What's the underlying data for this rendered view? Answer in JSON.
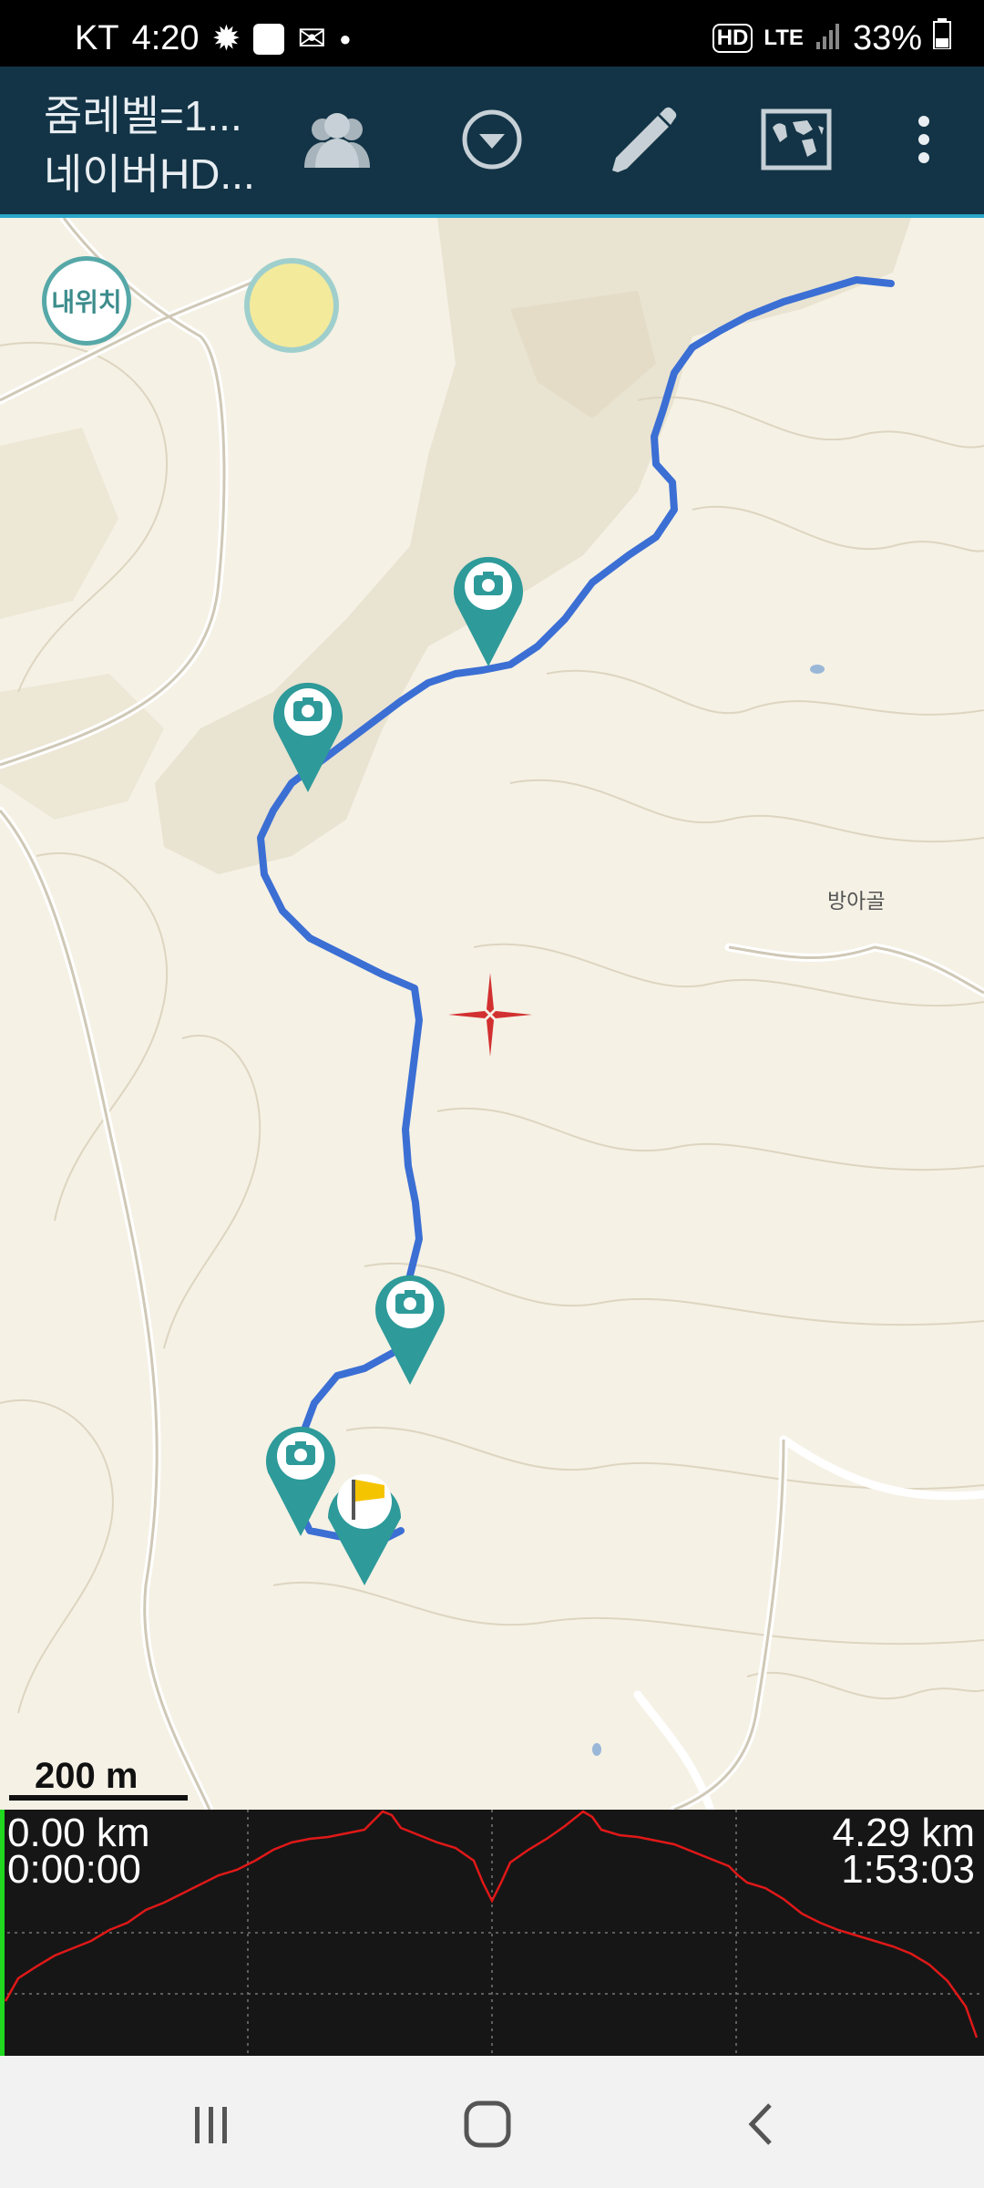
{
  "status_bar": {
    "carrier": "KT",
    "time": "4:20",
    "network": "LTE",
    "hd": "HD",
    "battery": "33%"
  },
  "toolbar": {
    "title_line1": "줌레벨=1...",
    "title_line2": "네이버HD...",
    "icons": [
      "group-icon",
      "dropdown-icon",
      "pencil-icon",
      "world-map-icon",
      "more-vert-icon"
    ]
  },
  "map": {
    "my_location_label": "내위치",
    "place_label": "방아골",
    "scale_label": "200 m",
    "markers": [
      "camera",
      "camera",
      "camera",
      "camera",
      "flag"
    ],
    "colors": {
      "track": "#3b6fd4",
      "marker": "#2e9a9a",
      "background": "#f5f1e5"
    }
  },
  "profile": {
    "start_distance": "0.00 km",
    "start_time": "0:00:00",
    "end_distance": "4.29 km",
    "end_time": "1:53:03",
    "line_color": "#e01818"
  }
}
